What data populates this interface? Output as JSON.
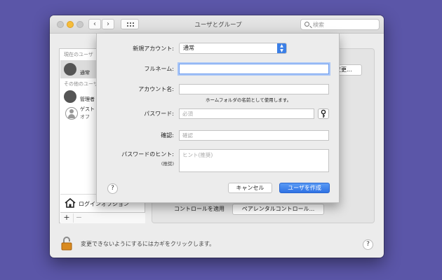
{
  "window": {
    "title": "ユーザとグループ",
    "search_placeholder": "検索"
  },
  "user_list": {
    "current_users_header": "現在のユーザ",
    "current_user": {
      "name": "通常"
    },
    "other_users_header": "その他のユーザ",
    "other_users": [
      {
        "name": "管理者",
        "sub": ""
      },
      {
        "name": "ゲスト",
        "sub": "オフ"
      }
    ],
    "login_options_label": "ログインオプション",
    "add_label": "+",
    "remove_label": "−"
  },
  "right_panel": {
    "change_button_label": "変更...",
    "parental_label": "コントロールを適用",
    "parental_button_label": "ペアレンタルコントロール..."
  },
  "footer": {
    "lock_text": "変更できないようにするにはカギをクリックします。",
    "help_label": "?"
  },
  "new_account_sheet": {
    "account_type_label": "新規アカウント:",
    "account_type_value": "通常",
    "full_name_label": "フルネーム:",
    "full_name_value": "",
    "account_name_label": "アカウント名:",
    "account_name_value": "",
    "account_name_hint": "ホームフォルダの名前として使用します。",
    "password_label": "パスワード:",
    "password_placeholder": "必須",
    "verify_label": "確認:",
    "verify_placeholder": "確認",
    "password_hint_label": "パスワードのヒント:",
    "password_hint_sublabel": "(推奨)",
    "password_hint_placeholder": "ヒント(推奨)",
    "help_label": "?",
    "cancel_label": "キャンセル",
    "create_label": "ユーザを作成"
  },
  "colors": {
    "desktop": "#5b56a8",
    "accent": "#3b7fe6"
  },
  "icons": [
    "back-icon",
    "forward-icon",
    "grid-icon",
    "search-icon",
    "house-icon",
    "lock-icon",
    "key-icon",
    "updown-arrows-icon"
  ]
}
